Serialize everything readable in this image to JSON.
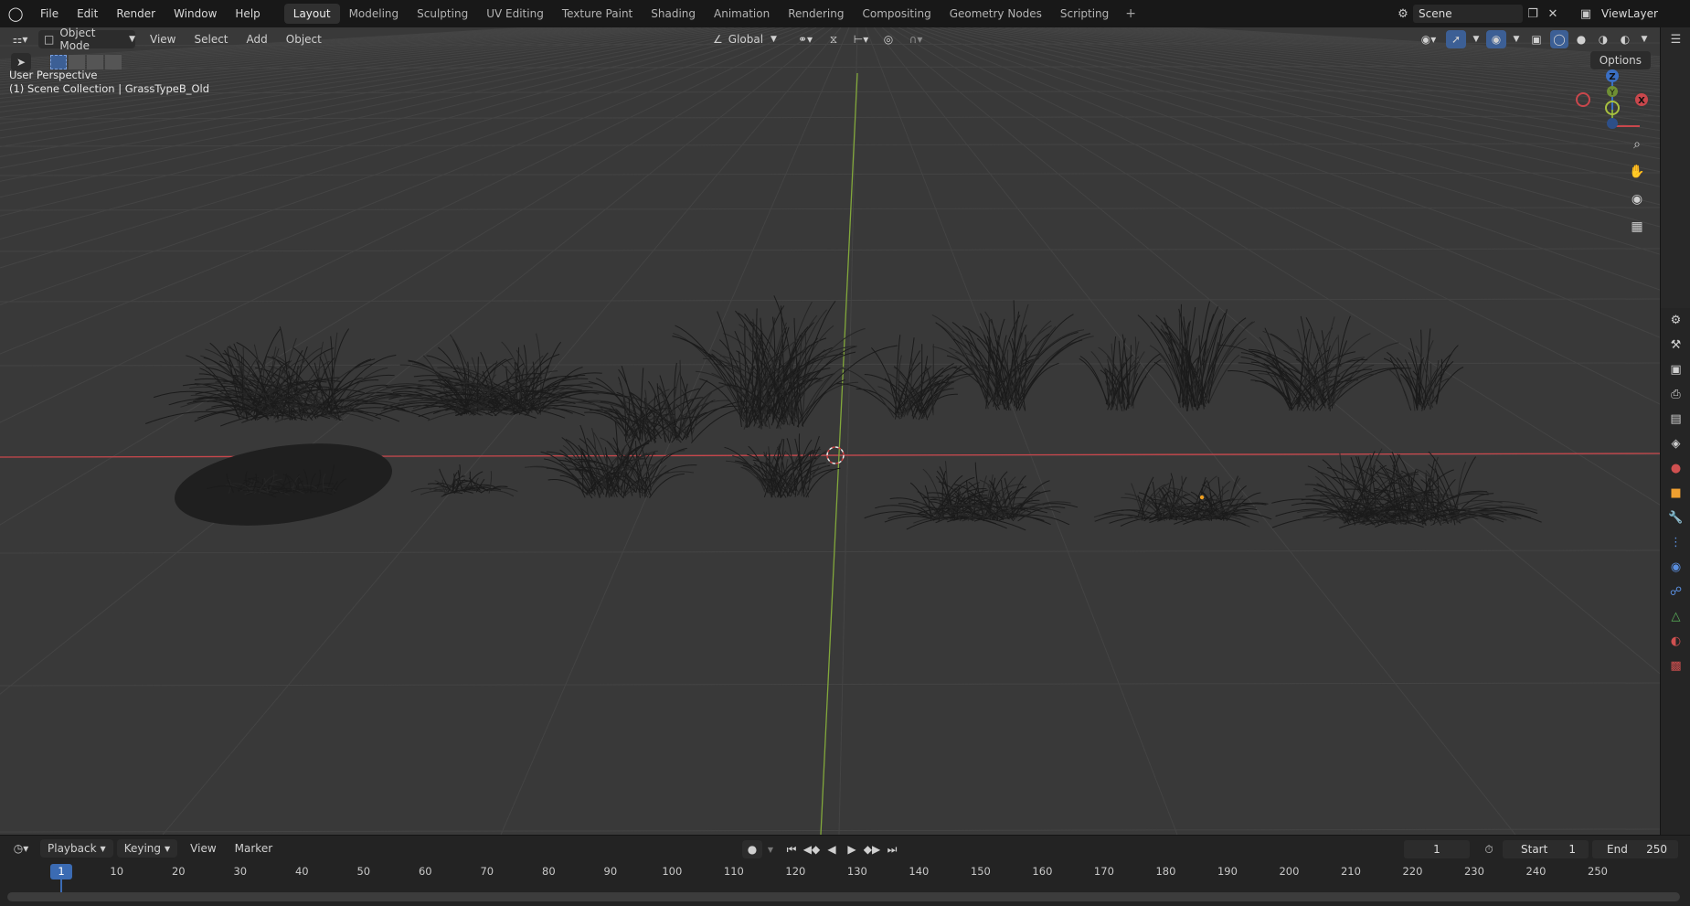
{
  "topbar": {
    "menus": [
      "File",
      "Edit",
      "Render",
      "Window",
      "Help"
    ],
    "workspaces": [
      "Layout",
      "Modeling",
      "Sculpting",
      "UV Editing",
      "Texture Paint",
      "Shading",
      "Animation",
      "Rendering",
      "Compositing",
      "Geometry Nodes",
      "Scripting"
    ],
    "active_workspace": "Layout",
    "scene_name": "Scene",
    "view_layer": "ViewLayer"
  },
  "viewport_header": {
    "mode": "Object Mode",
    "menus": [
      "View",
      "Select",
      "Add",
      "Object"
    ],
    "orientation": "Global",
    "options_label": "Options"
  },
  "viewport": {
    "perspective_label": "User Perspective",
    "collection_label": "(1) Scene Collection | GrassTypeB_Old",
    "gizmo": {
      "z": "Z",
      "y": "Y",
      "x": "X"
    },
    "background_color": "#393939",
    "x_axis_color": "#c9474c",
    "y_axis_color": "#82a83b"
  },
  "timeline": {
    "menus": [
      "Playback",
      "Keying",
      "View",
      "Marker"
    ],
    "current_frame": "1",
    "start_label": "Start",
    "start_value": "1",
    "end_label": "End",
    "end_value": "250",
    "ruler_ticks": [
      "1",
      "10",
      "20",
      "30",
      "40",
      "50",
      "60",
      "70",
      "80",
      "90",
      "100",
      "110",
      "120",
      "130",
      "140",
      "150",
      "160",
      "170",
      "180",
      "190",
      "200",
      "210",
      "220",
      "230",
      "240",
      "250"
    ]
  },
  "icons": {
    "blender_logo": "blender-logo-icon",
    "zoom": "zoom-icon",
    "pan": "hand-icon",
    "camera": "camera-icon",
    "grid": "ortho-grid-icon"
  }
}
